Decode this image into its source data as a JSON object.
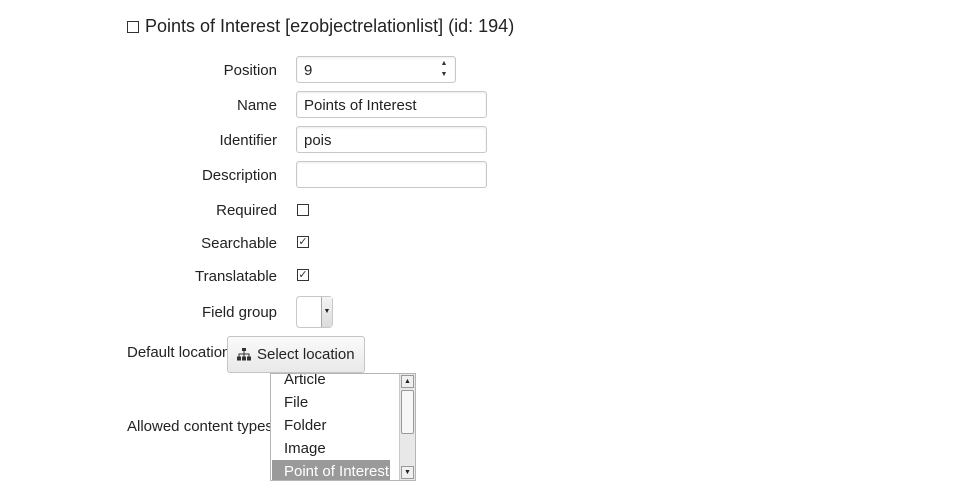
{
  "title": {
    "text": "Points of Interest [ezobjectrelationlist] (id: 194)"
  },
  "fields": {
    "position": {
      "label": "Position",
      "value": "9"
    },
    "name": {
      "label": "Name",
      "value": "Points of Interest"
    },
    "identifier": {
      "label": "Identifier",
      "value": "pois"
    },
    "description": {
      "label": "Description",
      "value": ""
    },
    "required": {
      "label": "Required",
      "checked": false
    },
    "searchable": {
      "label": "Searchable",
      "checked": true
    },
    "translatable": {
      "label": "Translatable",
      "checked": true
    },
    "field_group": {
      "label": "Field group",
      "value": ""
    }
  },
  "default_location": {
    "label": "Default location",
    "button_label": "Select location",
    "icon": "sitemap-icon"
  },
  "allowed_content_types": {
    "label": "Allowed content types",
    "items": [
      "Article",
      "File",
      "Folder",
      "Image",
      "Point of Interest"
    ],
    "selected": "Point of Interest"
  },
  "colors": {
    "selected_bg": "#9a9a9a",
    "text": "#222222"
  }
}
